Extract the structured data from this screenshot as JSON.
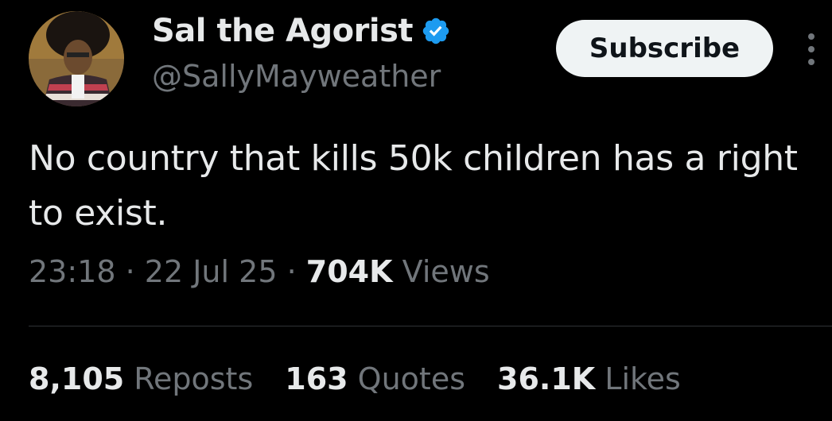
{
  "author": {
    "display_name": "Sal the Agorist",
    "handle": "@SallyMayweather",
    "verified": true,
    "verified_color": "#1d9bf0"
  },
  "actions": {
    "subscribe_label": "Subscribe"
  },
  "tweet": {
    "text": "No country that kills 50k children has a right to exist.",
    "time": "23:18",
    "separator": "·",
    "date": "22 Jul 25",
    "views_count": "704K",
    "views_label": "Views"
  },
  "stats": {
    "reposts_count": "8,105",
    "reposts_label": "Reposts",
    "quotes_count": "163",
    "quotes_label": "Quotes",
    "likes_count": "36.1K",
    "likes_label": "Likes"
  },
  "colors": {
    "background": "#000000",
    "primary_text": "#e7e9ea",
    "secondary_text": "#71767b",
    "divider": "#2f3336",
    "button_bg": "#eff3f4"
  }
}
